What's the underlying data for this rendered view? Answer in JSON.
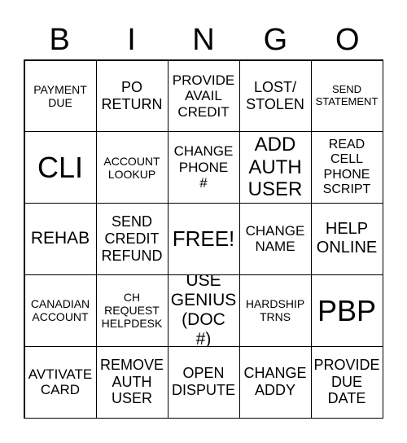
{
  "header": [
    "B",
    "I",
    "N",
    "G",
    "O"
  ],
  "cells": [
    [
      "PAYMENT DUE",
      "PO RETURN",
      "PROVIDE AVAIL CREDIT",
      "LOST/ STOLEN",
      "SEND STATEMENT"
    ],
    [
      "CLI",
      "ACCOUNT LOOKUP",
      "CHANGE PHONE #",
      "ADD AUTH USER",
      "READ CELL PHONE SCRIPT"
    ],
    [
      "REHAB",
      "SEND CREDIT REFUND",
      "FREE!",
      "CHANGE NAME",
      "HELP ONLINE"
    ],
    [
      "CANADIAN ACCOUNT",
      "CH REQUEST HELPDESK",
      "USE GENIUS (DOC #)",
      "HARDSHIP TRNS",
      "PBP"
    ],
    [
      "AVTIVATE CARD",
      "REMOVE AUTH USER",
      "OPEN DISPUTE",
      "CHANGE ADDY",
      "PROVIDE DUE DATE"
    ]
  ]
}
